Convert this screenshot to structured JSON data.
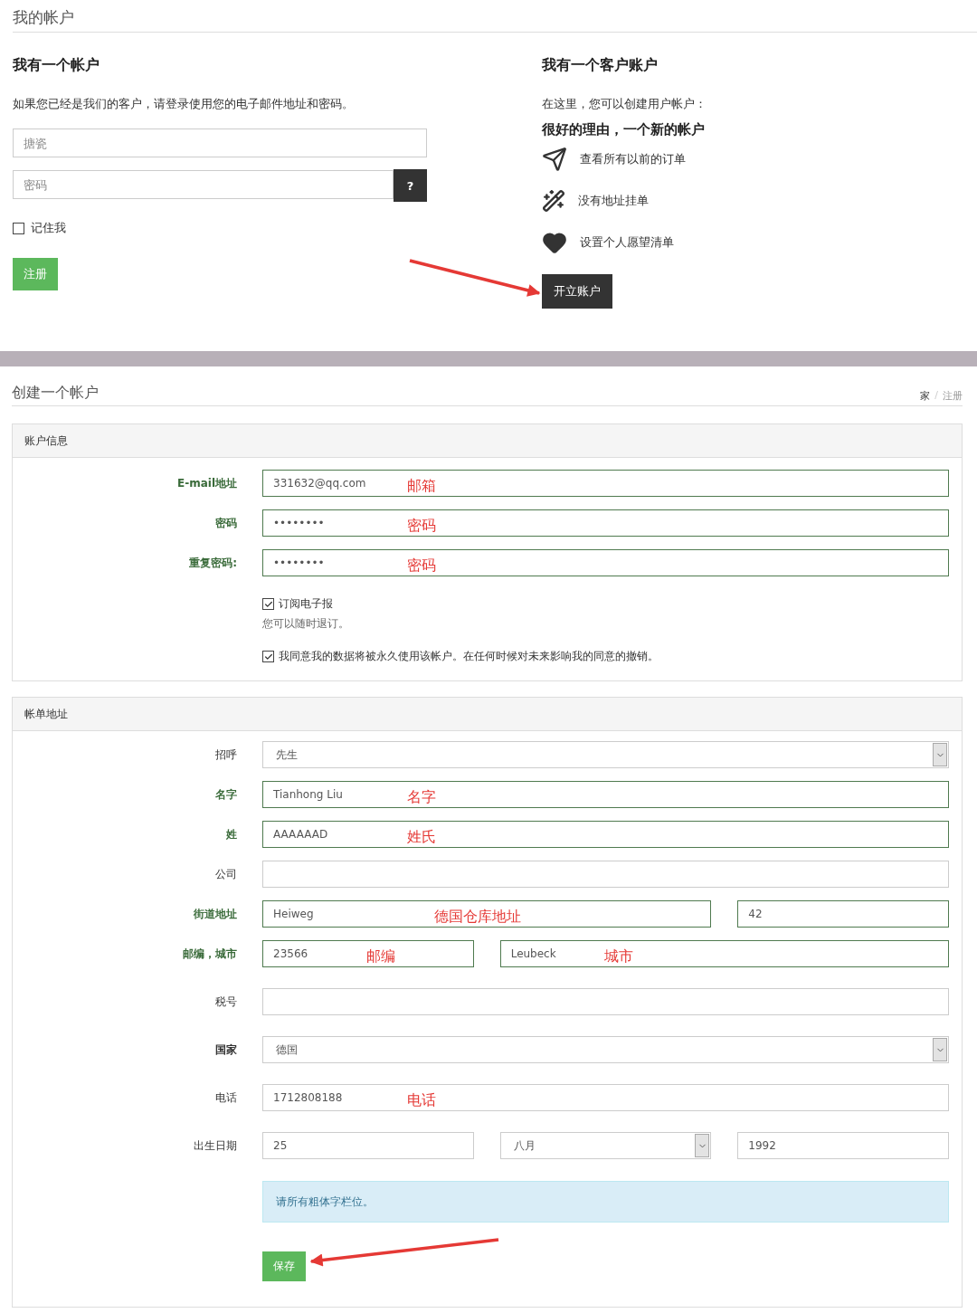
{
  "page_title": "我的帐户",
  "login": {
    "heading": "我有一个帐户",
    "intro": "如果您已经是我们的客户，请登录使用您的电子邮件地址和密码。",
    "username": {
      "placeholder": "搪瓷"
    },
    "password": {
      "placeholder": "密码"
    },
    "help_button": "?",
    "remember": {
      "label": "记住我",
      "checked": false
    },
    "submit": "注册"
  },
  "register": {
    "heading": "我有一个客户账户",
    "intro": "在这里，您可以创建用户帐户：",
    "subheading": "很好的理由，一个新的帐户",
    "benefits": [
      {
        "kind": "plane",
        "label": "查看所有以前的订单"
      },
      {
        "kind": "wand",
        "label": "没有地址挂单"
      },
      {
        "kind": "heart",
        "label": "设置个人愿望清单"
      }
    ],
    "button": "开立账户"
  },
  "create": {
    "title": "创建一个帐户",
    "breadcrumb": [
      {
        "label": "家",
        "current": false
      },
      {
        "label": "注册",
        "current": true
      }
    ],
    "separator": "/",
    "account": {
      "heading": "账户信息",
      "fields": [
        {
          "label": "E-mail地址",
          "required": true,
          "valid": true,
          "inputs": [
            {
              "kind": "text",
              "value": "331632@qq.com",
              "note": "邮箱"
            }
          ]
        },
        {
          "label": "密码",
          "required": true,
          "valid": true,
          "inputs": [
            {
              "kind": "text",
              "value": "••••••••",
              "note": "密码"
            }
          ]
        },
        {
          "label": "重复密码:",
          "required": true,
          "valid": true,
          "inputs": [
            {
              "kind": "text",
              "value": "••••••••",
              "note": "密码"
            }
          ]
        }
      ],
      "checkboxes": [
        {
          "label": "订阅电子报",
          "checked": true,
          "hint": "您可以随时退订。"
        },
        {
          "label": "我同意我的数据将被永久使用该帐户。在任何时候对未来影响我的同意的撤销。",
          "checked": true
        }
      ]
    },
    "billing": {
      "heading": "帐单地址",
      "fields": [
        {
          "label": "招呼",
          "required": false,
          "valid": false,
          "inputs": [
            {
              "kind": "select",
              "value": "先生"
            }
          ]
        },
        {
          "label": "名字",
          "required": true,
          "valid": true,
          "inputs": [
            {
              "kind": "text",
              "value": "Tianhong Liu",
              "note": "名字"
            }
          ]
        },
        {
          "label": "姓",
          "required": true,
          "valid": true,
          "inputs": [
            {
              "kind": "text",
              "value": "AAAAAAD",
              "note": "姓氏"
            }
          ]
        },
        {
          "label": "公司",
          "required": false,
          "valid": false,
          "inputs": [
            {
              "kind": "text"
            }
          ]
        },
        {
          "label": "街道地址",
          "required": true,
          "valid": true,
          "inputs": [
            {
              "kind": "text",
              "value": "Heiweg",
              "note": "德国仓库地址",
              "wide": true
            },
            {
              "kind": "text",
              "value": "42",
              "wide": false
            }
          ]
        },
        {
          "label": "邮编，城市",
          "required": true,
          "valid": true,
          "inputs": [
            {
              "kind": "text",
              "value": "23566",
              "note": "邮编",
              "wide": false
            },
            {
              "kind": "text",
              "value": "Leubeck",
              "note": "城市",
              "wide": true
            }
          ]
        },
        {
          "label": "税号",
          "required": false,
          "valid": false,
          "inputs": [
            {
              "kind": "text"
            }
          ]
        },
        {
          "label": "国家",
          "required": true,
          "valid": false,
          "inputs": [
            {
              "kind": "select",
              "value": "德国"
            }
          ]
        },
        {
          "label": "电话",
          "required": false,
          "valid": false,
          "inputs": [
            {
              "kind": "text",
              "value": "1712808188",
              "note": "电话"
            }
          ]
        },
        {
          "label": "出生日期",
          "required": false,
          "valid": false,
          "inputs": [
            {
              "kind": "text",
              "value": "25"
            },
            {
              "kind": "select",
              "value": "八月"
            },
            {
              "kind": "text",
              "value": "1992"
            }
          ]
        }
      ],
      "alert": "请所有粗体字栏位。",
      "save": "保存"
    }
  }
}
